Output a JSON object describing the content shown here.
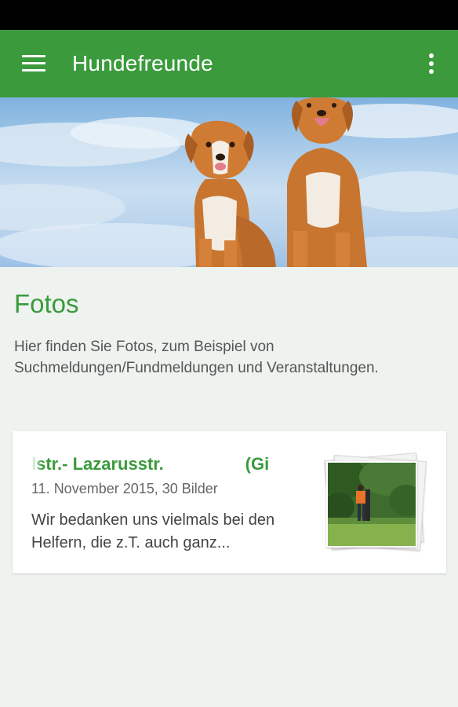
{
  "app_bar": {
    "title": "Hundefreunde",
    "menu_icon": "hamburger-menu-icon",
    "overflow_icon": "more-vert-icon",
    "color": "#3a9a3c"
  },
  "page": {
    "title": "Fotos",
    "description": "Hier finden Sie Fotos, zum Beispiel von Suchmeldungen/Fundmeldungen und Veranstaltungen."
  },
  "albums": [
    {
      "title": "lstr.- Lazarusstr.                 (Gi",
      "meta": "11. November 2015, 30 Bilder",
      "excerpt": "Wir bedanken uns vielmals bei den Helfern, die z.T. auch ganz..."
    }
  ]
}
